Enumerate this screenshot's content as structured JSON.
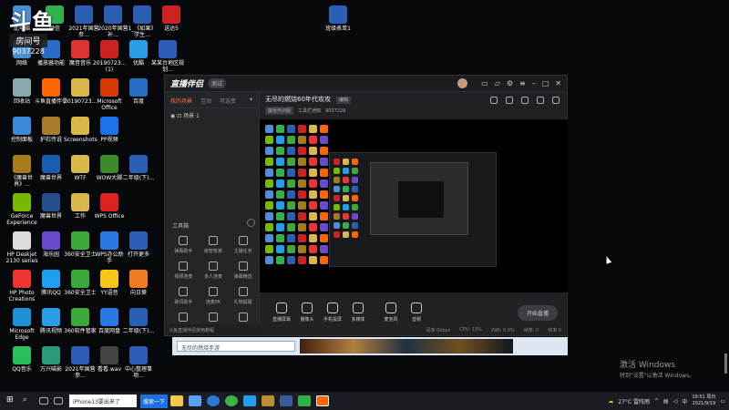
{
  "watermark": {
    "logo": "斗鱼",
    "room_label": "房间号",
    "room_number": "9037228"
  },
  "desktop_icons": [
    {
      "label": "此电脑",
      "color": "#4a8fd8"
    },
    {
      "label": "微信",
      "color": "#2fb24c"
    },
    {
      "label": "2021年国营参...",
      "color": "#2b5fb5"
    },
    {
      "label": "2020年国营补...",
      "color": "#2b5fb5"
    },
    {
      "label": "1_《如果》学生...",
      "color": "#2b5fb5"
    },
    {
      "label": "送达5",
      "color": "#c22"
    },
    {
      "label": "网络",
      "color": "#4a8fd8"
    },
    {
      "label": "播放器功能",
      "color": "#2a6dc4"
    },
    {
      "label": "魔音音乐",
      "color": "#d33"
    },
    {
      "label": "20190723...(1)",
      "color": "#c22"
    },
    {
      "label": "优酷",
      "color": "#2a9de8"
    },
    {
      "label": "某某台地区规划...",
      "color": "#2b5fb5"
    },
    {
      "label": "回收站",
      "color": "#8aa"
    },
    {
      "label": "斗鱼直播伴侣",
      "color": "#f60"
    },
    {
      "label": "20190723...",
      "color": "#d9b84a"
    },
    {
      "label": "Microsoft Office",
      "color": "#d83b01"
    },
    {
      "label": "百度",
      "color": "#2a6dc4"
    },
    {
      "label": "控制面板",
      "color": "#3a88d8"
    },
    {
      "label": "护石传说",
      "color": "#a57c2a"
    },
    {
      "label": "Screenshots",
      "color": "#d9b84a"
    },
    {
      "label": "PP视频",
      "color": "#1a74e8"
    },
    {
      "label": "《魔兽世界》...",
      "color": "#a67c1b"
    },
    {
      "label": "魔兽世界",
      "color": "#1a5cb0"
    },
    {
      "label": "WTF",
      "color": "#d9b84a"
    },
    {
      "label": "WOW大脚",
      "color": "#3a8a2a"
    },
    {
      "label": "二年级(下)...",
      "color": "#2b5fb5"
    },
    {
      "label": "GeForce Experience",
      "color": "#76b900"
    },
    {
      "label": "魔兽世界",
      "color": "#244d8a"
    },
    {
      "label": "工作",
      "color": "#d9b84a"
    },
    {
      "label": "WPS Office",
      "color": "#d22"
    },
    {
      "label": "HP Deskjet 2130 series",
      "color": "#ddd"
    },
    {
      "label": "海乐园",
      "color": "#6a4bd0"
    },
    {
      "label": "360安全卫士",
      "color": "#3aa83a"
    },
    {
      "label": "WPS办公助手",
      "color": "#2b78e4"
    },
    {
      "label": "打开更多",
      "color": "#2b5fb5"
    },
    {
      "label": "HP Photo Creations",
      "color": "#e33"
    },
    {
      "label": "腾讯QQ",
      "color": "#1ea0f0"
    },
    {
      "label": "360安全卫士",
      "color": "#3aa83a"
    },
    {
      "label": "YY语音",
      "color": "#f5c518"
    },
    {
      "label": "向日葵",
      "color": "#f07b22"
    },
    {
      "label": "Microsoft Edge",
      "color": "#1f8fd6"
    },
    {
      "label": "腾讯视频",
      "color": "#2b9de8"
    },
    {
      "label": "360软件管家",
      "color": "#3aa83a"
    },
    {
      "label": "百度网盘",
      "color": "#2b78e4"
    },
    {
      "label": "二年级(下)...",
      "color": "#2b5fb5"
    },
    {
      "label": "QQ音乐",
      "color": "#2cbd5c"
    },
    {
      "label": "万兴喵影",
      "color": "#2a9a7a"
    },
    {
      "label": "2021年国营参...",
      "color": "#2b5fb5"
    },
    {
      "label": "看看.wav",
      "color": "#444"
    },
    {
      "label": "中心整理事项...",
      "color": "#2b5fb5"
    },
    {
      "label": "班级表单1",
      "color": "#2b5fb5"
    }
  ],
  "app": {
    "brand": "直播伴侣",
    "version_badge": "测试",
    "left_tabs": [
      "我的场景",
      "互动",
      "可选变"
    ],
    "scene_name": "场景 1",
    "tools_title": "工具箱",
    "tools": [
      "弹幕助手",
      "房管管家",
      "主播任务",
      "视频连麦",
      "多人连麦",
      "弹幕精选",
      "歌词助手",
      "连麦PK",
      "礼物提醒",
      "美颜设置",
      "更多",
      ""
    ],
    "left_footer": "斗鱼直播伴侣使用教程",
    "stream_title": "无尽的燃烧60年代攻攻",
    "edit_btn": "编辑",
    "category": "魔兽怀旧服",
    "room_label": "工具栏通知",
    "room_number": "9037228",
    "controls": [
      "直播屏幕",
      "摄像头",
      "手机投屏",
      "多媒体",
      "麦克风",
      "音频"
    ],
    "start_btn": "开始直播",
    "status": [
      "码率 0kbps",
      "CPU: 13%",
      "内存: 0.0%",
      "帧率: 0",
      "帧率 0"
    ]
  },
  "chat": {
    "placeholder": "无尽的燃烧手游"
  },
  "activation": {
    "line1": "激活 Windows",
    "line2": "转到\"设置\"以激活 Windows。"
  },
  "taskbar": {
    "search_text": "iPhone13要出来了",
    "search_button": "搜索一下",
    "weather": "27°C 雷阵雨",
    "time": "19:51 周日",
    "date": "2021/9/19"
  }
}
